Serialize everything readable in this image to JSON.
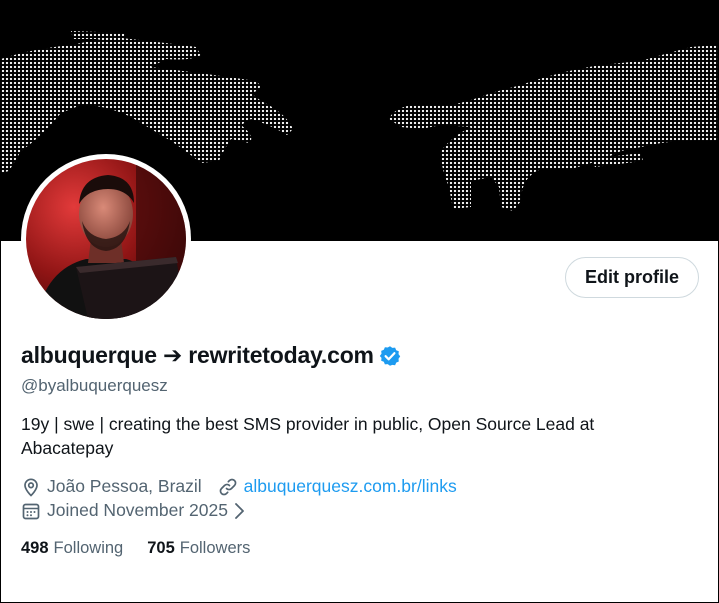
{
  "profile": {
    "display_name": "albuquerque ➔ rewritetoday.com",
    "handle": "@byalbuquerquesz",
    "verified": true,
    "bio": "19y | swe | creating the best SMS provider in public, Open Source Lead at Abacatepay",
    "location": "João Pessoa, Brazil",
    "website": "albuquerquesz.com.br/links",
    "joined": "Joined November 2025",
    "edit_profile_label": "Edit profile"
  },
  "stats": {
    "following_count": "498",
    "following_label": "Following",
    "followers_count": "705",
    "followers_label": "Followers"
  },
  "icons": {
    "location": "location-pin-icon",
    "link": "link-icon",
    "calendar": "calendar-icon",
    "chevron": "chevron-right-icon",
    "verified": "verified-badge-icon"
  },
  "colors": {
    "accent": "#1d9bf0",
    "secondary_text": "#536471",
    "primary_text": "#0f1419",
    "banner_bg": "#000000"
  }
}
